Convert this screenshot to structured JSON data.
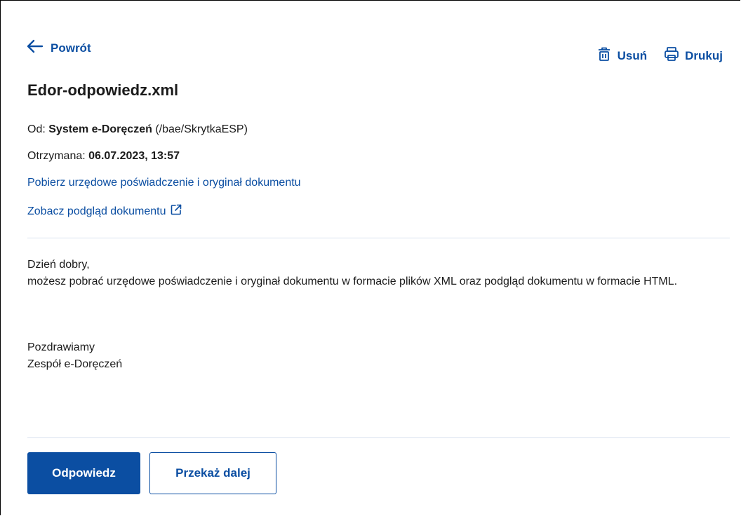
{
  "nav": {
    "back_label": "Powrót"
  },
  "actions": {
    "delete_label": "Usuń",
    "print_label": "Drukuj"
  },
  "message": {
    "title": "Edor-odpowiedz.xml",
    "from_label": "Od:",
    "from_name": "System e-Doręczeń",
    "from_address": "(/bae/SkrytkaESP)",
    "received_label": "Otrzymana:",
    "received_value": "06.07.2023, 13:57",
    "download_link": "Pobierz urzędowe poświadczenie i oryginał dokumentu",
    "preview_link": "Zobacz podgląd dokumentu",
    "greeting": "Dzień dobry,",
    "body": "możesz pobrać urzędowe poświadczenie i oryginał dokumentu w formacie plików XML oraz podgląd dokumentu w formacie HTML.",
    "closing": "Pozdrawiamy",
    "signature": "Zespół e-Doręczeń"
  },
  "footer": {
    "reply_label": "Odpowiedz",
    "forward_label": "Przekaż dalej"
  },
  "colors": {
    "accent": "#0b4ea2",
    "divider": "#d9e2ee",
    "text": "#1b1b1b"
  },
  "icons": {
    "back": "arrow-left-icon",
    "delete": "trash-icon",
    "print": "printer-icon",
    "external": "external-link-icon"
  }
}
